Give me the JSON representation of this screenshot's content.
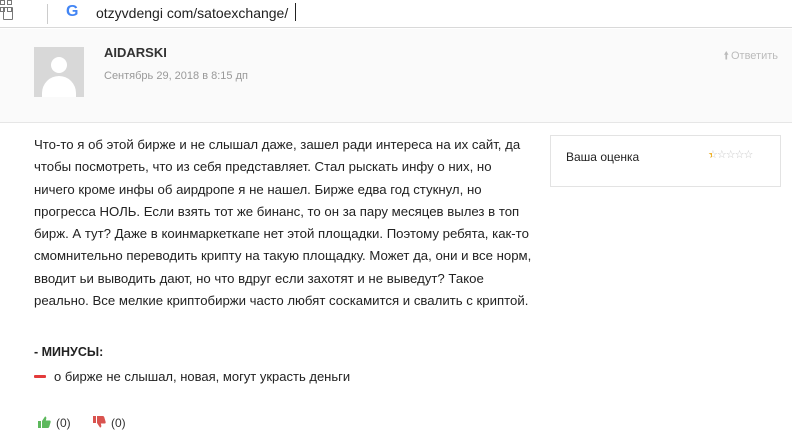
{
  "browser": {
    "url": "otzyvdengi com/satoexchange/"
  },
  "comment": {
    "author": "AIDARSKI",
    "date": "Сентябрь 29, 2018 в 8:15 дп",
    "reply_label": "Ответить",
    "body": "Что-то я об этой бирже и не слышал даже, зашел ради интереса на их сайт, да чтобы посмотреть, что из себя представляет. Стал рыскать инфу о них, но ничего кроме инфы об аирдропе я не нашел. Бирже едва год стукнул, но прогресса НОЛЬ. Если взять тот же бинанс, то он за пару месяцев вылез в топ бирж. А тут? Даже в коинмаркеткапе нет этой площадки. Поэтому ребята, как-то смомнительно переводить крипту на такую площадку. Может да, они и все норм, вводит ьи выводить дают, но что вдруг если захотят и не выведут? Такое реально. Все мелкие криптобиржи часто любят соскамится и свалить с криптой.",
    "cons_title": "- МИНУСЫ:",
    "cons_text": "о бирже не слышал, новая, могут украсть деньги",
    "likes": "(0)",
    "dislikes": "(0)"
  },
  "rating": {
    "label": "Ваша оценка",
    "value": 0.5,
    "max": 5,
    "filled_color": "#f2b01e",
    "empty_color": "#c8c8c8"
  },
  "colors": {
    "minus": "#e33b3b",
    "thumb_up": "#5cb85c",
    "thumb_down": "#d9534f"
  }
}
